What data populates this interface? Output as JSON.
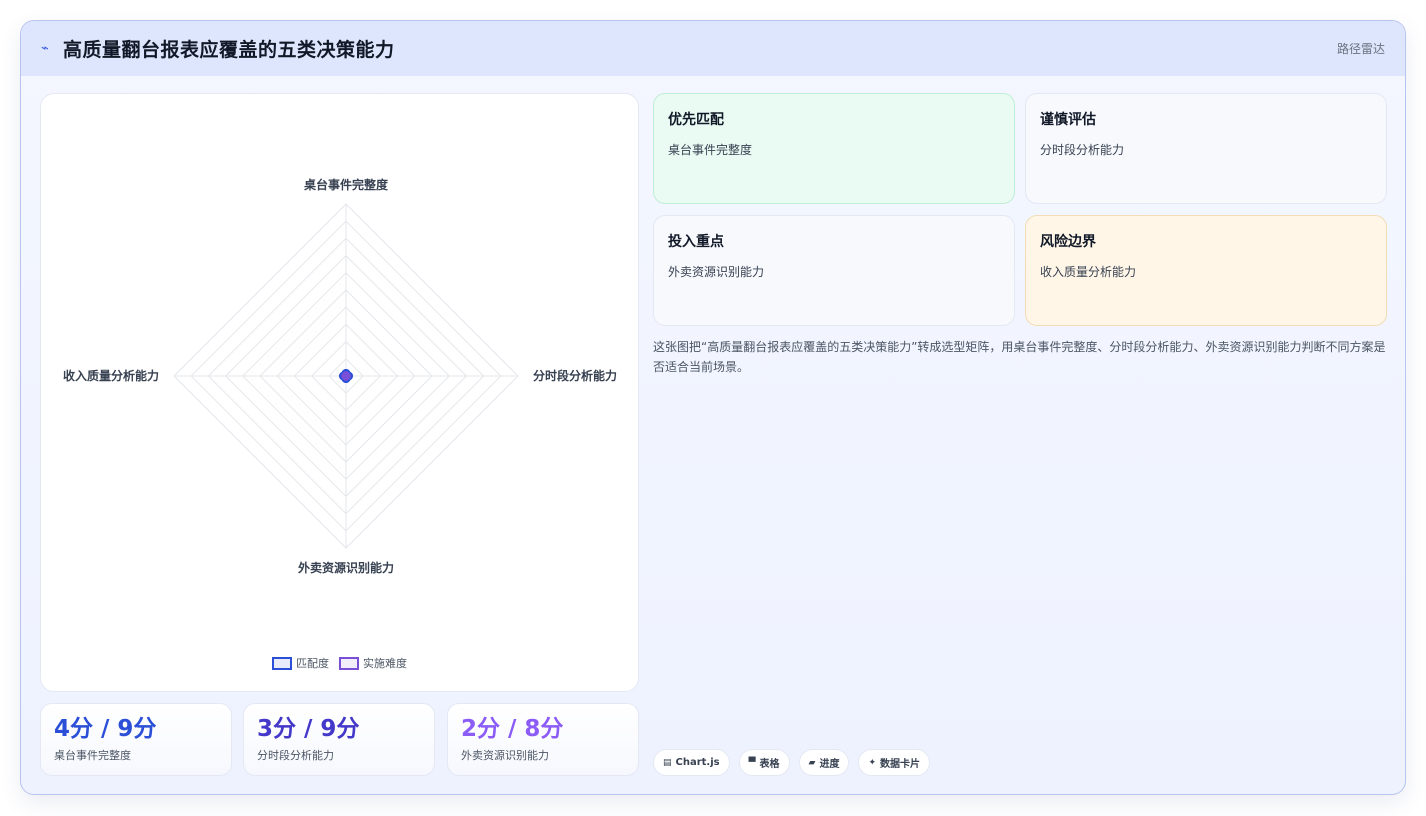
{
  "header": {
    "logo_icon": "sparkle-icon",
    "logo_glyph": "⌁",
    "title": "高质量翻台报表应覆盖的五类决策能力",
    "tag": "路径雷达"
  },
  "chart_data": {
    "type": "radar",
    "axes": [
      "桌台事件完整度",
      "分时段分析能力",
      "外卖资源识别能力",
      "收入质量分析能力"
    ],
    "range": [
      0,
      10
    ],
    "grid_levels": 10,
    "legend_position": "bottom",
    "series": [
      {
        "name": "匹配度",
        "values": [
          0.15,
          0.15,
          0.15,
          0.15
        ],
        "color": "#2b4fd6",
        "fill": "rgba(43,79,214,0.10)"
      },
      {
        "name": "实施难度",
        "values": [
          0.08,
          0.08,
          0.08,
          0.08
        ],
        "color": "#7a4fd8",
        "fill": "rgba(122,79,216,0.10)"
      }
    ]
  },
  "stats": [
    {
      "value": "4分 / 9分",
      "label": "桌台事件完整度",
      "color": "#2b4fd6"
    },
    {
      "value": "3分 / 9分",
      "label": "分时段分析能力",
      "color": "#4338ca"
    },
    {
      "value": "2分 / 8分",
      "label": "外卖资源识别能力",
      "color": "#8b5cf6"
    }
  ],
  "decisions": [
    {
      "title": "优先匹配",
      "value": "桌台事件完整度"
    },
    {
      "title": "谨慎评估",
      "value": "分时段分析能力"
    },
    {
      "title": "投入重点",
      "value": "外卖资源识别能力"
    },
    {
      "title": "风险边界",
      "value": "收入质量分析能力"
    }
  ],
  "description": "这张图把“高质量翻台报表应覆盖的五类决策能力”转成选型矩阵，用桌台事件完整度、分时段分析能力、外卖资源识别能力判断不同方案是否适合当前场景。",
  "chips": [
    {
      "icon": "chart-icon",
      "glyph": "▤",
      "label": "Chart.js"
    },
    {
      "icon": "table-icon",
      "glyph": "▀",
      "label": "表格"
    },
    {
      "icon": "progress-icon",
      "glyph": "▰",
      "label": "进度"
    },
    {
      "icon": "card-icon",
      "glyph": "✦",
      "label": "数据卡片"
    }
  ]
}
